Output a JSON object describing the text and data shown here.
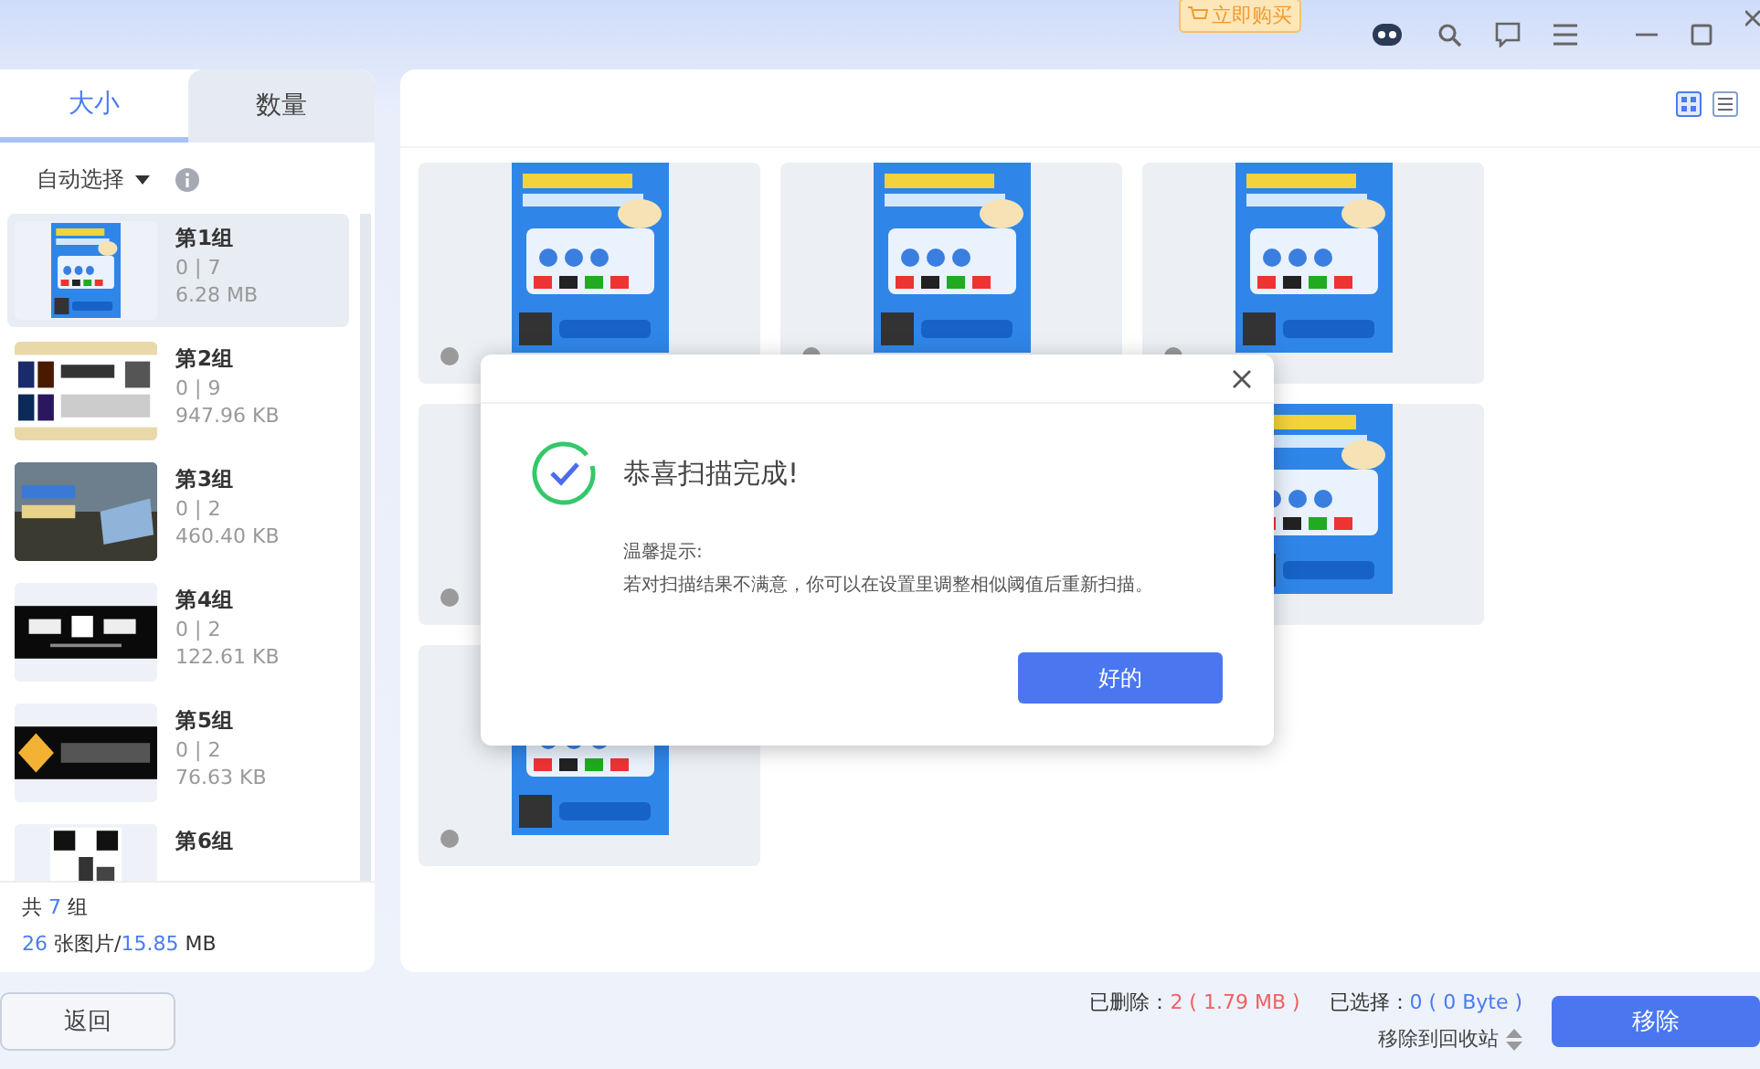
{
  "top_bar": {
    "buy_badge": "立即购买"
  },
  "tabs": [
    {
      "label": "大小",
      "selected": true
    },
    {
      "label": "数量",
      "selected": false
    }
  ],
  "auto_select": {
    "label": "自动选择"
  },
  "groups": [
    {
      "name": "第1组",
      "count": "0 | 7",
      "size": "6.28 MB",
      "selected": true
    },
    {
      "name": "第2组",
      "count": "0 | 9",
      "size": "947.96 KB",
      "selected": false
    },
    {
      "name": "第3组",
      "count": "0 | 2",
      "size": "460.40 KB",
      "selected": false
    },
    {
      "name": "第4组",
      "count": "0 | 2",
      "size": "122.61 KB",
      "selected": false
    },
    {
      "name": "第5组",
      "count": "0 | 2",
      "size": "76.63 KB",
      "selected": false
    },
    {
      "name": "第6组",
      "selected": false
    }
  ],
  "summary": {
    "line1": [
      {
        "text": "共 ",
        "highlight": false
      },
      {
        "text": "7",
        "highlight": true
      },
      {
        "text": " 组",
        "highlight": false
      }
    ],
    "line2": [
      {
        "text": "26",
        "highlight": true
      },
      {
        "text": " 张图片/",
        "highlight": false
      },
      {
        "text": "15.85",
        "highlight": true
      },
      {
        "text": " MB",
        "highlight": false
      }
    ]
  },
  "gallery": {
    "cards": [
      {
        "kind": "picture"
      },
      {
        "kind": "picture"
      },
      {
        "kind": "picture"
      },
      {
        "kind": "radio-only"
      },
      {
        "kind": "covered"
      },
      {
        "kind": "picture-only"
      },
      {
        "kind": "picture"
      }
    ]
  },
  "dialog": {
    "title": "恭喜扫描完成!",
    "hint_title": "温馨提示:",
    "hint": "若对扫描结果不满意，你可以在设置里调整相似阈值后重新扫描。",
    "ok_button": "好的"
  },
  "footer": {
    "back_button": "返回",
    "deleted_label": "已删除：",
    "deleted_value": "2 ( 1.79 MB )",
    "selected_label": "已选择：",
    "selected_value": "0 ( 0 Byte )",
    "target": "移除到回收站",
    "remove_button": "移除"
  }
}
